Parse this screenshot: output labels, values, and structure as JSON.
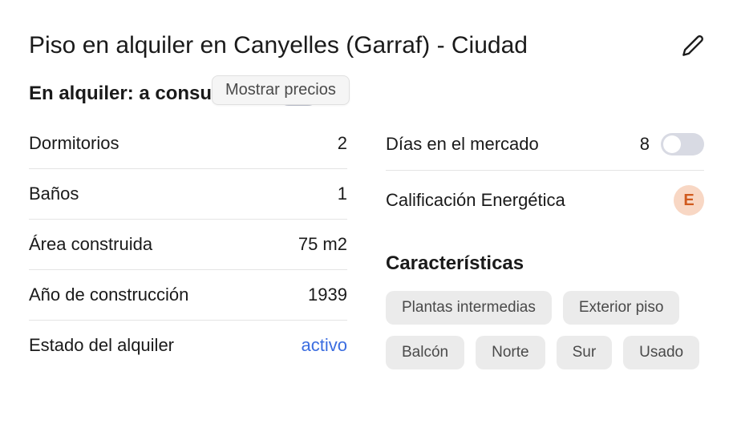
{
  "header": {
    "title": "Piso en alquiler en Canyelles (Garraf) - Ciudad"
  },
  "tooltip": {
    "text": "Mostrar precios"
  },
  "price": {
    "text": "En alquiler: a consultar/m"
  },
  "left_stats": [
    {
      "label": "Dormitorios",
      "value": "2"
    },
    {
      "label": "Baños",
      "value": "1"
    },
    {
      "label": "Área construida",
      "value": "75 m2"
    },
    {
      "label": "Año de construcción",
      "value": "1939"
    },
    {
      "label": "Estado del alquiler",
      "value": "activo",
      "is_link": true
    }
  ],
  "right_stats": [
    {
      "label": "Días en el mercado",
      "value": "8",
      "has_toggle": true
    },
    {
      "label": "Calificación Energética",
      "value": "E",
      "is_energy": true
    }
  ],
  "features": {
    "title": "Características",
    "tags": [
      "Plantas intermedias",
      "Exterior piso",
      "Balcón",
      "Norte",
      "Sur",
      "Usado"
    ]
  }
}
